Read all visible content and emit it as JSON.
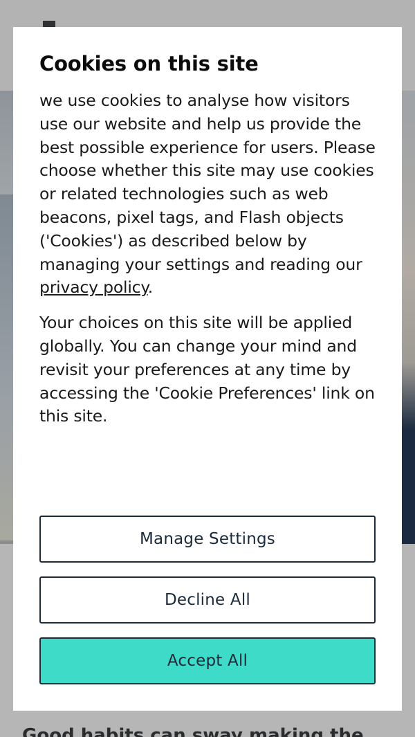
{
  "background_page": {
    "heading_partial": "Good habits can sway making the"
  },
  "cookie_modal": {
    "title": "Cookies on this site",
    "paragraph1_text": "we use cookies to analyse how visitors use our website and help us provide the best possible experience for users. Please choose whether this site may use cookies or related technologies such as web beacons, pixel tags, and Flash objects ('Cookies') as described below by managing your settings and reading our ",
    "privacy_link_label": "privacy policy",
    "paragraph1_end": ".",
    "paragraph2": "Your choices on this site will be applied globally. You can change your mind and revisit your preferences at any time by accessing the 'Cookie Preferences' link on this site.",
    "buttons": {
      "manage_settings": "Manage Settings",
      "decline_all": "Decline All",
      "accept_all": "Accept All"
    }
  },
  "colors": {
    "accent": "#3fdbc9",
    "button_border": "#1c2b3a",
    "overlay_background": "#b5b5b5"
  }
}
